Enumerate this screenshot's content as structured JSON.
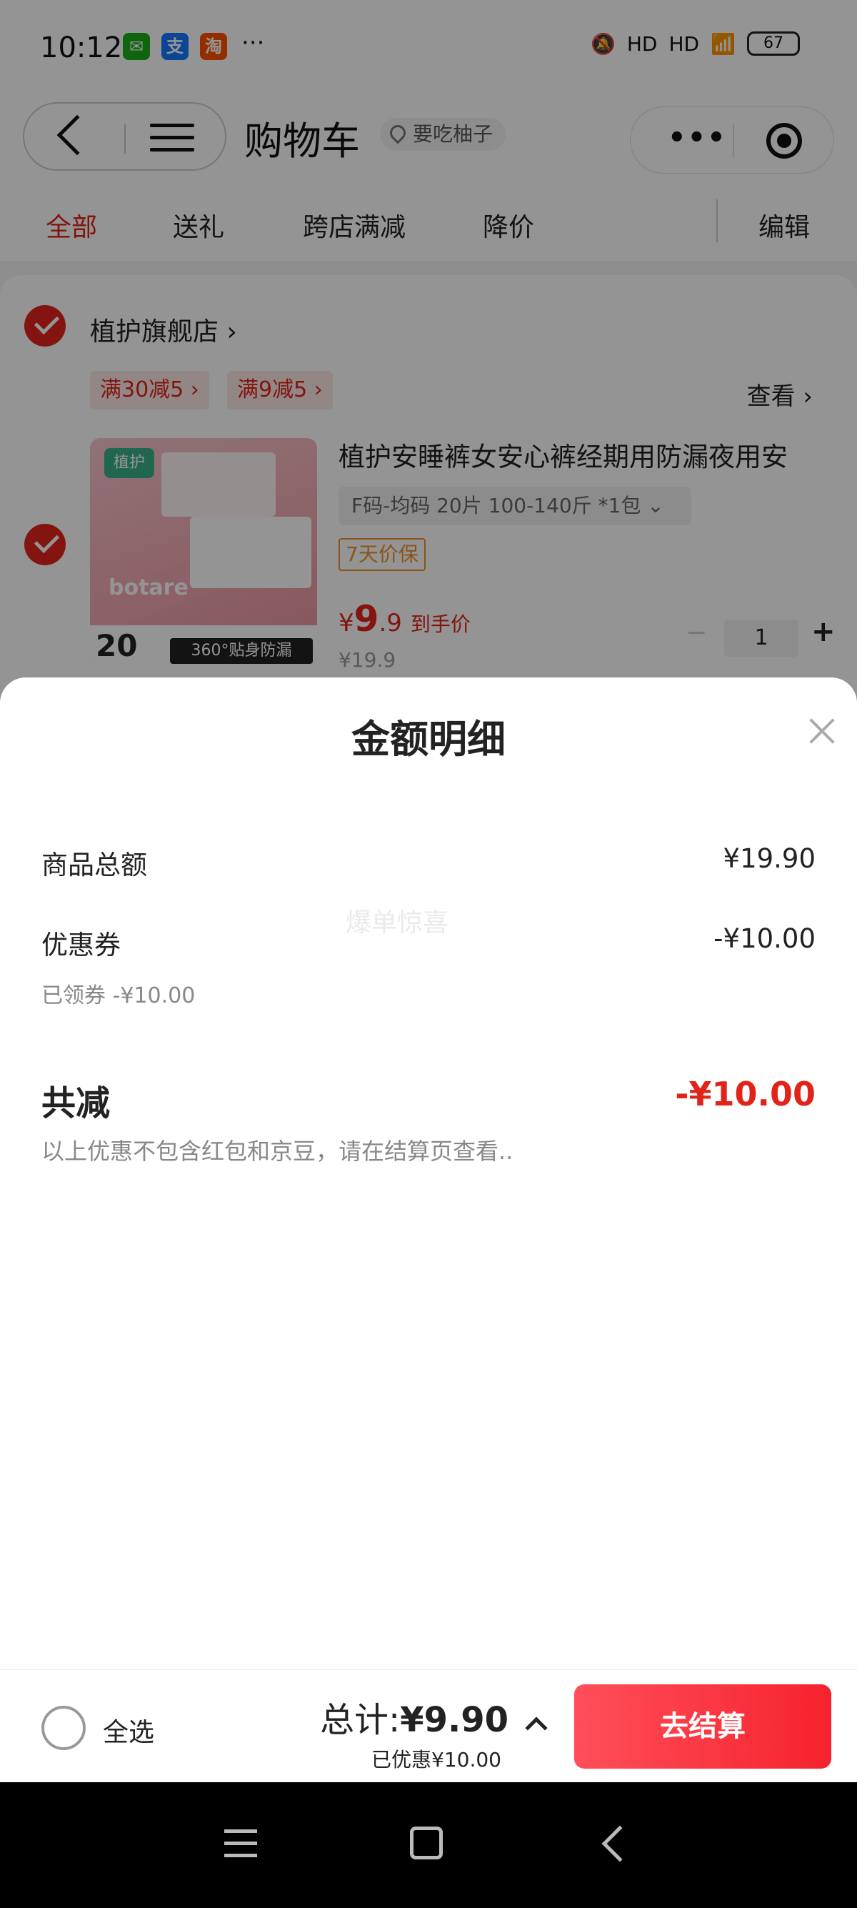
{
  "status_bar": {
    "time": "10:12",
    "more": "···",
    "battery": "67",
    "signal_label": "HD",
    "apps": [
      {
        "name": "wechat-icon",
        "glyph": "✉",
        "color": "#1aad19"
      },
      {
        "name": "alipay-icon",
        "glyph": "支",
        "color": "#1677ff"
      },
      {
        "name": "app-icon",
        "glyph": "淘",
        "color": "#ff5000"
      }
    ]
  },
  "nav": {
    "title": "购物车",
    "location": "要吃柚子",
    "capsule_dots": "•••"
  },
  "tabs": [
    {
      "label": "全部",
      "active": true
    },
    {
      "label": "送礼",
      "active": false
    },
    {
      "label": "跨店满减",
      "active": false
    },
    {
      "label": "降价",
      "active": false
    }
  ],
  "edit_label": "编辑",
  "shop": {
    "name": "植护旗舰店 ›",
    "promos": [
      "满30减5 ›",
      "满9减5 ›"
    ],
    "view_more": "查看 ›"
  },
  "product": {
    "title": "植护安睡裤女安心裤经期用防漏夜用安",
    "spec": "F码-均码 20片 100-140斤 *1包  ⌄",
    "warranty": "7天价保",
    "price_symbol": "¥",
    "price_int": "9",
    "price_dec": ".9",
    "price_note": "到手价",
    "old_price": "¥19.9",
    "quantity": "1",
    "image_text": {
      "logo": "植护",
      "brand": "botare",
      "count": "20",
      "band": "360°贴身防漏"
    }
  },
  "sheet": {
    "title": "金额明细",
    "watermark": "爆单惊喜",
    "rows": [
      {
        "label": "商品总额",
        "value": "¥19.90"
      },
      {
        "label": "优惠券",
        "value": "-¥10.00",
        "sub": "已领券 -¥10.00"
      }
    ],
    "total_label": "共减",
    "total_value": "-¥10.00",
    "note": "以上优惠不包含红包和京豆，请在结算页查看.."
  },
  "bottom": {
    "select_all": "全选",
    "total_prefix": "总计:",
    "total_value": "¥9.90",
    "saved": "已优惠¥10.00",
    "checkout": "去结算"
  },
  "colors": {
    "accent": "#e2231a",
    "warranty": "#f0922d"
  }
}
